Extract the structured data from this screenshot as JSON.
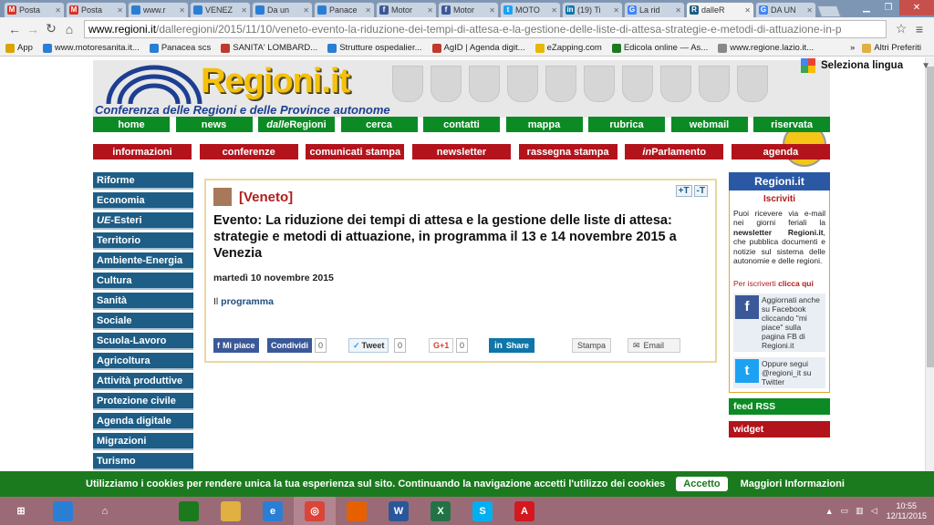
{
  "browser": {
    "tabs": [
      {
        "title": "Posta",
        "icon": "gmail-icon",
        "color": "#d93025",
        "glyph": "M"
      },
      {
        "title": "Posta",
        "icon": "gmail-icon",
        "color": "#d93025",
        "glyph": "M"
      },
      {
        "title": "www.r",
        "icon": "loading-icon",
        "color": "#2a7fd4",
        "glyph": ""
      },
      {
        "title": "VENEZ",
        "icon": "loading-icon",
        "color": "#2a7fd4",
        "glyph": ""
      },
      {
        "title": "Da un",
        "icon": "loading-icon",
        "color": "#2a7fd4",
        "glyph": ""
      },
      {
        "title": "Panace",
        "icon": "loading-icon",
        "color": "#2a7fd4",
        "glyph": ""
      },
      {
        "title": "Motor",
        "icon": "facebook-icon",
        "color": "#3b5998",
        "glyph": "f"
      },
      {
        "title": "Motor",
        "icon": "facebook-icon",
        "color": "#3b5998",
        "glyph": "f"
      },
      {
        "title": "MOTO",
        "icon": "twitter-icon",
        "color": "#1da1f2",
        "glyph": "t"
      },
      {
        "title": "(19) Ti",
        "icon": "linkedin-icon",
        "color": "#0e76a8",
        "glyph": "in"
      },
      {
        "title": "La rid",
        "icon": "google-icon",
        "color": "#4285f4",
        "glyph": "G"
      },
      {
        "title": "dalleR",
        "icon": "regioni-icon",
        "color": "#1d5d86",
        "glyph": "R",
        "active": true
      },
      {
        "title": "DA UN",
        "icon": "google-icon",
        "color": "#4285f4",
        "glyph": "G"
      }
    ],
    "url_host": "www.regioni.it",
    "url_path": "/dalleregioni/2015/11/10/veneto-evento-la-riduzione-dei-tempi-di-attesa-e-la-gestione-delle-liste-di-attesa-strategie-e-metodi-di-attuazione-in-p",
    "bookmarks": [
      {
        "label": "App",
        "color": "#d9a400"
      },
      {
        "label": "www.motoresanita.it...",
        "color": "#2a7fd4"
      },
      {
        "label": "Panacea scs",
        "color": "#2a7fd4"
      },
      {
        "label": "SANITA' LOMBARD...",
        "color": "#c0392b"
      },
      {
        "label": "Strutture ospedalier...",
        "color": "#2a7fd4"
      },
      {
        "label": "AgID | Agenda digit...",
        "color": "#c0392b"
      },
      {
        "label": "eZapping.com",
        "color": "#e6b800"
      },
      {
        "label": "Edicola online — As...",
        "color": "#1b7a1e"
      },
      {
        "label": "www.regione.lazio.it...",
        "color": "#888888"
      }
    ],
    "bookmarks_more": "»",
    "other_bookmarks": "Altri Preferiti"
  },
  "site": {
    "logo": "Regioni.it",
    "subtitle": "Conferenza delle Regioni e delle Province autonome",
    "language": "Seleziona lingua",
    "menu1": [
      {
        "pre": "",
        "label": "home"
      },
      {
        "pre": "",
        "label": "news"
      },
      {
        "pre": "dalle",
        "label": "Regioni"
      },
      {
        "pre": "",
        "label": "cerca"
      },
      {
        "pre": "",
        "label": "contatti"
      },
      {
        "pre": "",
        "label": "mappa"
      },
      {
        "pre": "",
        "label": "rubrica"
      },
      {
        "pre": "",
        "label": "webmail"
      },
      {
        "pre": "",
        "label": "riservata"
      }
    ],
    "menu2": [
      {
        "pre": "",
        "label": "informazioni"
      },
      {
        "pre": "",
        "label": "conferenze"
      },
      {
        "pre": "",
        "label": "comunicati stampa"
      },
      {
        "pre": "",
        "label": "newsletter"
      },
      {
        "pre": "",
        "label": "rassegna stampa"
      },
      {
        "pre": "in",
        "label": "Parlamento"
      },
      {
        "pre": "",
        "label": "agenda"
      }
    ],
    "sidebar": [
      {
        "pre": "",
        "label": "Riforme"
      },
      {
        "pre": "",
        "label": "Economia"
      },
      {
        "pre": "UE",
        "label": "-Esteri"
      },
      {
        "pre": "",
        "label": "Territorio"
      },
      {
        "pre": "",
        "label": "Ambiente-Energia"
      },
      {
        "pre": "",
        "label": "Cultura"
      },
      {
        "pre": "",
        "label": "Sanità"
      },
      {
        "pre": "",
        "label": "Sociale"
      },
      {
        "pre": "",
        "label": "Scuola-Lavoro"
      },
      {
        "pre": "",
        "label": "Agricoltura"
      },
      {
        "pre": "",
        "label": "Attività produttive"
      },
      {
        "pre": "",
        "label": "Protezione civile"
      },
      {
        "pre": "",
        "label": "Agenda digitale"
      },
      {
        "pre": "",
        "label": "Migrazioni"
      },
      {
        "pre": "",
        "label": "Turismo"
      }
    ]
  },
  "article": {
    "region": "[Veneto]",
    "text_plus": "+T",
    "text_minus": "-T",
    "title": "Evento: La riduzione dei tempi di attesa e la gestione delle liste di attesa: strategie e metodi di attuazione, in programma il 13 e 14 novembre 2015 a Venezia",
    "date": "martedì 10 novembre 2015",
    "body_prefix": "Il",
    "body_link": "programma",
    "social": {
      "like": "Mi piace",
      "share": "Condividi",
      "share_count": "0",
      "tweet": "Tweet",
      "tweet_count": "0",
      "gplus": "G+1",
      "gplus_count": "0",
      "linkedin": "Share",
      "print": "Stampa",
      "email": "Email"
    }
  },
  "rightcol": {
    "logo": "Regioni.it",
    "iscritti_title": "Iscriviti",
    "iscritti_text_a": "Puoi ricevere via e-mail nei giorni feriali la ",
    "iscritti_text_b": "newsletter Regioni.it",
    "iscritti_text_c": ", che pubblica documenti e notizie sul sistema delle autonomie e delle regioni.",
    "subscribe_prefix": "Per iscriverti ",
    "subscribe_link": "clicca qui",
    "facebook_text": "Aggiornati anche su Facebook cliccando \"mi piace\" sulla pagina FB di Regioni.it",
    "twitter_text": "Oppure segui @regioni_it su Twitter",
    "feed": "feed RSS",
    "widget": "widget"
  },
  "cookie": {
    "text": "Utilizziamo i cookies per rendere unica la tua esperienza sul sito. Continuando la navigazione accetti l'utilizzo dei cookies",
    "accept": "Accetto",
    "more": "Maggiori Informazioni"
  },
  "taskbar": {
    "apps": [
      {
        "name": "start-button",
        "color": "#9a6b77",
        "glyph": "⊞"
      },
      {
        "name": "desktop-app",
        "color": "#2a7fd4",
        "glyph": ""
      },
      {
        "name": "home-app",
        "color": "#9a6b77",
        "glyph": "⌂"
      },
      {
        "name": "document-app",
        "color": "#9a6b77",
        "glyph": ""
      },
      {
        "name": "store-app",
        "color": "#1b7a1e",
        "glyph": ""
      },
      {
        "name": "file-explorer-app",
        "color": "#e0b040",
        "glyph": ""
      },
      {
        "name": "internet-explorer-app",
        "color": "#2a7fd4",
        "glyph": "e"
      },
      {
        "name": "chrome-app",
        "color": "#db4437",
        "glyph": "◎"
      },
      {
        "name": "firefox-app",
        "color": "#e66000",
        "glyph": ""
      },
      {
        "name": "word-app",
        "color": "#2b579a",
        "glyph": "W"
      },
      {
        "name": "excel-app",
        "color": "#217346",
        "glyph": "X"
      },
      {
        "name": "skype-app",
        "color": "#00aff0",
        "glyph": "S"
      },
      {
        "name": "acrobat-app",
        "color": "#d4181f",
        "glyph": "A"
      }
    ],
    "time": "10:55",
    "date": "12/11/2015"
  }
}
